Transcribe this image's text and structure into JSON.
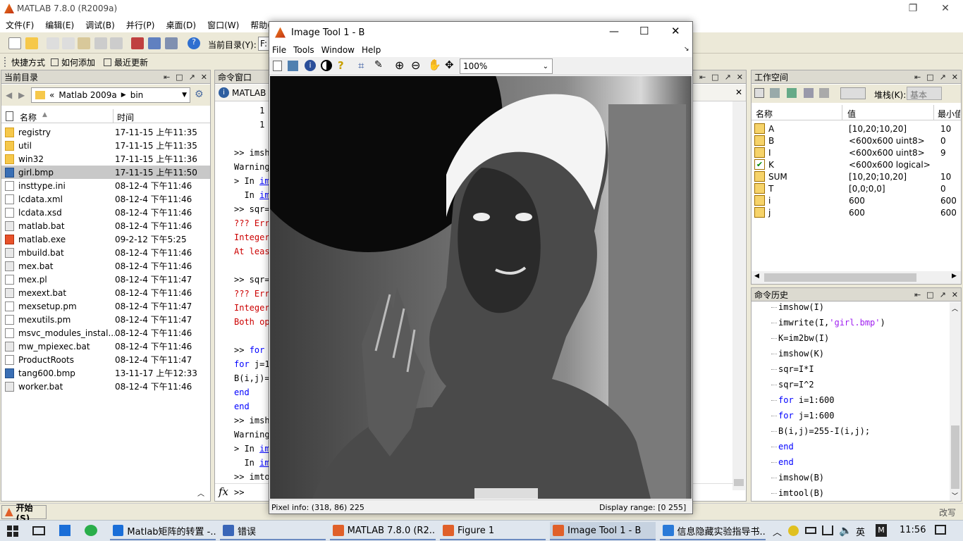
{
  "app": {
    "title": "MATLAB  7.8.0 (R2009a)"
  },
  "menu": [
    "文件(F)",
    "编辑(E)",
    "调试(B)",
    "并行(P)",
    "桌面(D)",
    "窗口(W)",
    "帮助(H)"
  ],
  "toolbar": {
    "current_dir_label": "当前目录(Y):",
    "current_dir_value": "F:"
  },
  "shortcuts": {
    "label": "快捷方式",
    "how_to_add": "如何添加",
    "latest": "最近更新"
  },
  "current_dir": {
    "title": "当前目录",
    "path": [
      "Matlab 2009a",
      "bin"
    ],
    "path_prefix": "«",
    "col_name": "名称",
    "col_time": "时间",
    "files": [
      {
        "name": "registry",
        "time": "17-11-15 上午11:35",
        "type": "folder"
      },
      {
        "name": "util",
        "time": "17-11-15 上午11:35",
        "type": "folder"
      },
      {
        "name": "win32",
        "time": "17-11-15 上午11:36",
        "type": "folder"
      },
      {
        "name": "girl.bmp",
        "time": "17-11-15 上午11:50",
        "type": "bmp"
      },
      {
        "name": "insttype.ini",
        "time": "08-12-4 下午11:46",
        "type": "file"
      },
      {
        "name": "lcdata.xml",
        "time": "08-12-4 下午11:46",
        "type": "file"
      },
      {
        "name": "lcdata.xsd",
        "time": "08-12-4 下午11:46",
        "type": "file"
      },
      {
        "name": "matlab.bat",
        "time": "08-12-4 下午11:46",
        "type": "bat"
      },
      {
        "name": "matlab.exe",
        "time": "09-2-12 下午5:25",
        "type": "exe"
      },
      {
        "name": "mbuild.bat",
        "time": "08-12-4 下午11:46",
        "type": "bat"
      },
      {
        "name": "mex.bat",
        "time": "08-12-4 下午11:46",
        "type": "bat"
      },
      {
        "name": "mex.pl",
        "time": "08-12-4 下午11:47",
        "type": "file"
      },
      {
        "name": "mexext.bat",
        "time": "08-12-4 下午11:46",
        "type": "bat"
      },
      {
        "name": "mexsetup.pm",
        "time": "08-12-4 下午11:47",
        "type": "file"
      },
      {
        "name": "mexutils.pm",
        "time": "08-12-4 下午11:47",
        "type": "file"
      },
      {
        "name": "msvc_modules_instal...",
        "time": "08-12-4 下午11:46",
        "type": "file"
      },
      {
        "name": "mw_mpiexec.bat",
        "time": "08-12-4 下午11:46",
        "type": "bat"
      },
      {
        "name": "ProductRoots",
        "time": "08-12-4 下午11:47",
        "type": "file"
      },
      {
        "name": "tang600.bmp",
        "time": "13-11-17 上午12:33",
        "type": "bmp"
      },
      {
        "name": "worker.bat",
        "time": "08-12-4 下午11:46",
        "type": "bat"
      }
    ]
  },
  "command_window": {
    "title": "命令窗口",
    "tab": "MATLAB",
    "lines": [
      {
        "text": "     1",
        "cls": ""
      },
      {
        "text": "     1",
        "cls": ""
      },
      {
        "text": "",
        "cls": ""
      },
      {
        "text": ">> imsh",
        "cls": ""
      },
      {
        "text": "Warning",
        "cls": ""
      },
      {
        "text": "> In im",
        "cls": "linkpart"
      },
      {
        "text": "  In im",
        "cls": "linkpart"
      },
      {
        "text": ">> sqr=",
        "cls": ""
      },
      {
        "text": "??? Err",
        "cls": "red"
      },
      {
        "text": "Integer",
        "cls": "red"
      },
      {
        "text": "At leas",
        "cls": "red"
      },
      {
        "text": "",
        "cls": ""
      },
      {
        "text": ">> sqr=",
        "cls": ""
      },
      {
        "text": "??? Err",
        "cls": "red"
      },
      {
        "text": "Integer",
        "cls": "red"
      },
      {
        "text": "Both op",
        "cls": "red"
      },
      {
        "text": "",
        "cls": ""
      },
      {
        "text": ">> for",
        "cls": "forline"
      },
      {
        "text": "for j=1",
        "cls": "forline2"
      },
      {
        "text": "B(i,j)=",
        "cls": ""
      },
      {
        "text": "end",
        "cls": "blue"
      },
      {
        "text": "end",
        "cls": "blue"
      },
      {
        "text": ">> imsh",
        "cls": ""
      },
      {
        "text": "Warning",
        "cls": ""
      },
      {
        "text": "> In im",
        "cls": "linkpart"
      },
      {
        "text": "  In im",
        "cls": "linkpart"
      },
      {
        "text": ">> imto",
        "cls": ""
      }
    ],
    "prompt": ">>"
  },
  "workspace": {
    "title": "工作空间",
    "stack_label": "堆栈(K):",
    "stack_value": "基本",
    "col_name": "名称",
    "col_value": "值",
    "col_min": "最小值",
    "vars": [
      {
        "name": "A",
        "value": "[10,20;10,20]",
        "min": "10"
      },
      {
        "name": "B",
        "value": "<600x600 uint8>",
        "min": "0"
      },
      {
        "name": "I",
        "value": "<600x600 uint8>",
        "min": "9"
      },
      {
        "name": "K",
        "value": "<600x600 logical>",
        "min": ""
      },
      {
        "name": "SUM",
        "value": "[10,20;10,20]",
        "min": "10"
      },
      {
        "name": "T",
        "value": "[0,0;0,0]",
        "min": "0"
      },
      {
        "name": "i",
        "value": "600",
        "min": "600"
      },
      {
        "name": "j",
        "value": "600",
        "min": "600"
      }
    ]
  },
  "history": {
    "title": "命令历史",
    "items": [
      "imshow(I)",
      "imwrite(I,'girl.bmp')",
      "K=im2bw(I)",
      "imshow(K)",
      "sqr=I*I",
      "sqr=I^2",
      "for i=1:600",
      "for j=1:600",
      "B(i,j)=255-I(i,j);",
      "end",
      "end",
      "imshow(B)",
      "imtool(B)"
    ]
  },
  "image_tool": {
    "title": "Image Tool 1 - B",
    "menu": [
      "File",
      "Tools",
      "Window",
      "Help"
    ],
    "zoom": "100%",
    "pixel_info": "Pixel info: (318, 86)  225",
    "display_range": "Display range: [0 255]"
  },
  "statusbar": {
    "start": "开始(S)",
    "ime": "改写"
  },
  "taskbar": {
    "items": [
      "Matlab矩阵的转置 -...",
      "错误",
      "MATLAB  7.8.0 (R2...",
      "Figure 1",
      "Image Tool 1 - B",
      "信息隐藏实验指导书..."
    ],
    "lang": "英",
    "time": "11:56"
  }
}
